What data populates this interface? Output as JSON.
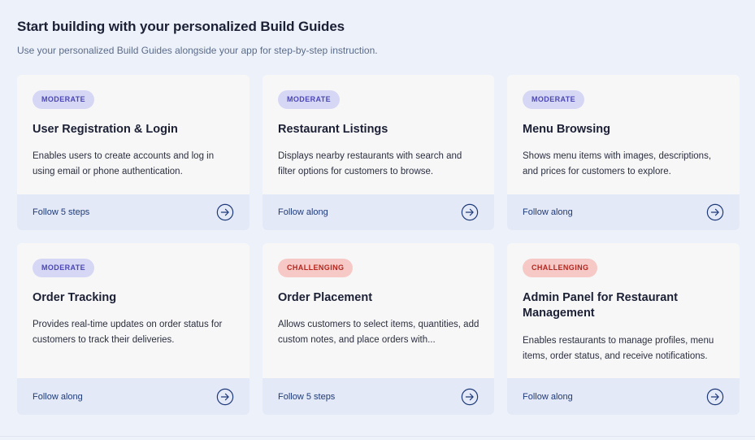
{
  "header": {
    "title": "Start building with your personalized Build Guides",
    "subtitle": "Use your personalized Build Guides alongside your app for step-by-step instruction."
  },
  "colors": {
    "accent": "#1f3a7a",
    "moderate_bg": "#d6d7f4",
    "moderate_text": "#4b47b5",
    "challenging_bg": "#f6c9c6",
    "challenging_text": "#b3261e"
  },
  "cards": [
    {
      "difficulty": "MODERATE",
      "title": "User Registration & Login",
      "description": "Enables users to create accounts and log in using email or phone authentication.",
      "action": "Follow 5 steps",
      "icon": "arrow-right-circle-icon"
    },
    {
      "difficulty": "MODERATE",
      "title": "Restaurant Listings",
      "description": "Displays nearby restaurants with search and filter options for customers to browse.",
      "action": "Follow along",
      "icon": "arrow-right-circle-icon"
    },
    {
      "difficulty": "MODERATE",
      "title": "Menu Browsing",
      "description": "Shows menu items with images, descriptions, and prices for customers to explore.",
      "action": "Follow along",
      "icon": "arrow-right-circle-icon"
    },
    {
      "difficulty": "MODERATE",
      "title": "Order Tracking",
      "description": "Provides real-time updates on order status for customers to track their deliveries.",
      "action": "Follow along",
      "icon": "arrow-right-circle-icon"
    },
    {
      "difficulty": "CHALLENGING",
      "title": "Order Placement",
      "description": "Allows customers to select items, quantities, add custom notes, and place orders with...",
      "action": "Follow 5 steps",
      "icon": "arrow-right-circle-icon"
    },
    {
      "difficulty": "CHALLENGING",
      "title": "Admin Panel for Restaurant Management",
      "description": "Enables restaurants to manage profiles, menu items, order status, and receive notifications.",
      "action": "Follow along",
      "icon": "arrow-right-circle-icon"
    }
  ]
}
